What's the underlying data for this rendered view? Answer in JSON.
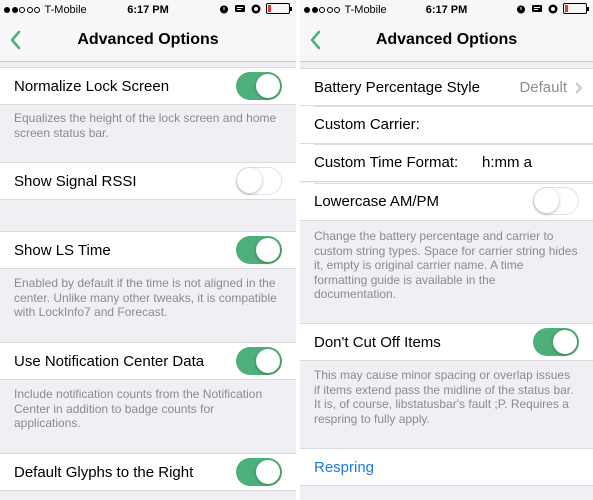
{
  "status_bar": {
    "carrier": "T-Mobile",
    "time": "6:17 PM"
  },
  "nav": {
    "title": "Advanced Options"
  },
  "left_panel": {
    "normalize_lock_screen": {
      "label": "Normalize Lock Screen",
      "on": true,
      "footer": "Equalizes the height of the lock screen and home screen status bar."
    },
    "show_signal_rssi": {
      "label": "Show Signal RSSI",
      "on": false
    },
    "show_ls_time": {
      "label": "Show LS Time",
      "on": true,
      "footer": "Enabled by default if the time is not aligned in the center. Unlike many other tweaks, it is compatible with LockInfo7 and Forecast."
    },
    "use_notification_center_data": {
      "label": "Use Notification Center Data",
      "on": true,
      "footer": "Include notification counts from the Notification Center in addition to badge counts for applications."
    },
    "default_glyphs_right": {
      "label": "Default Glyphs to the Right",
      "on": true
    }
  },
  "right_panel": {
    "battery_percentage_style": {
      "label": "Battery Percentage Style",
      "value": "Default"
    },
    "custom_carrier": {
      "label": "Custom Carrier:",
      "value": ""
    },
    "custom_time_format": {
      "label": "Custom Time Format:",
      "value": "h:mm a"
    },
    "lowercase_ampm": {
      "label": "Lowercase AM/PM",
      "on": false
    },
    "format_footer": "Change the battery percentage and carrier to custom string types. Space for carrier string hides it, empty is original carrier name. A time formatting guide is available in the documentation.",
    "dont_cut_off_items": {
      "label": "Don't Cut Off Items",
      "on": true,
      "footer": "This may cause minor spacing or overlap issues if items extend pass the midline of the status bar. It is, of course, libstatusbar's fault ;P. Requires a respring to fully apply."
    },
    "respring_label": "Respring"
  },
  "colors": {
    "toggle_on": "#4db07a",
    "accent": "#1c7be0",
    "battery_low": "#e13a31",
    "background": "#efeff4"
  }
}
